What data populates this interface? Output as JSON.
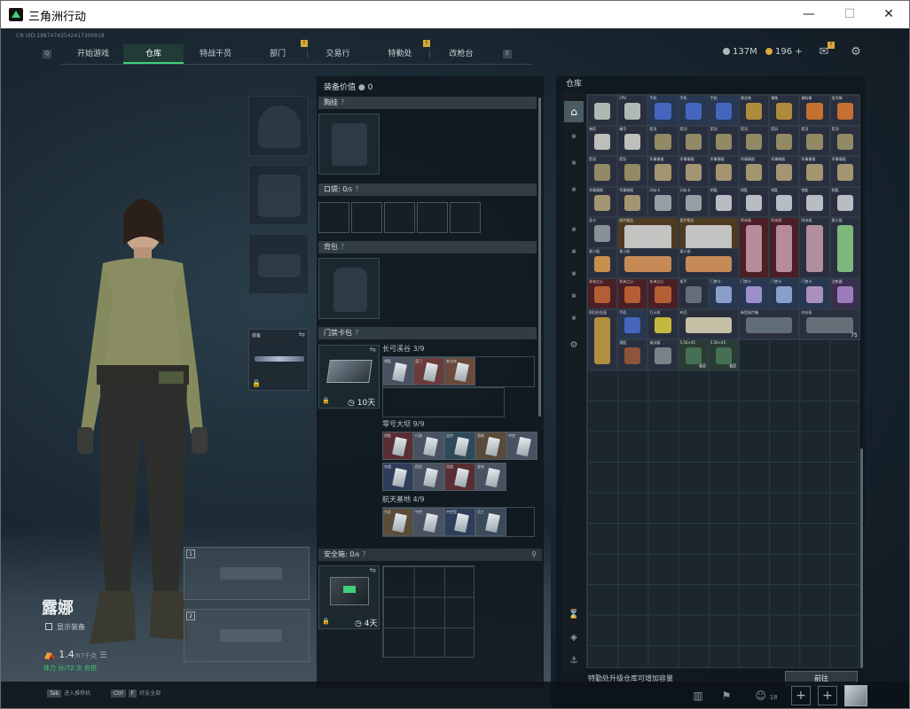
{
  "window": {
    "title": "三角洲行动",
    "minimize": "—",
    "maximize": "☐",
    "close": "✕"
  },
  "uid": "CN UID:18874742542417300918",
  "nav": {
    "left_key": "Q",
    "right_key": "E",
    "tabs": [
      {
        "label": "开始游戏"
      },
      {
        "label": "仓库",
        "active": true
      },
      {
        "label": "特战干员"
      },
      {
        "label": "部门",
        "badge": "!"
      },
      {
        "label": "交易行"
      },
      {
        "label": "特勤处",
        "badge": "!"
      },
      {
        "label": "改枪台"
      }
    ]
  },
  "currency": {
    "primary": "137M",
    "secondary": "196",
    "plus": "+"
  },
  "character": {
    "name": "露娜",
    "show_gear": "显示装备",
    "weight": "1.4",
    "weight_max": "/87千克",
    "weight_status": "体力 分/72 次 负担",
    "weapon_slot_title": "装备",
    "primary_slot": "1",
    "secondary_slot": "2"
  },
  "loadout": {
    "equip_value_label": "装备价值",
    "equip_value": "0",
    "chest": "胸挂",
    "pocket": "口袋",
    "pocket_count": "0",
    "pocket_max": "/5",
    "backpack": "背包",
    "keycard": "门禁卡包",
    "keycard_timer": "10天",
    "safebox": "安全箱",
    "safebox_count": "0",
    "safebox_max": "/6",
    "safebox_timer": "4天",
    "maps": [
      {
        "name": "长弓溪谷",
        "count": "3/9",
        "cards": [
          "钥匙",
          "蓝门",
          "老仓库"
        ]
      },
      {
        "name": "零号大坝",
        "count": "9/9",
        "cards": [
          "钥匙",
          "行政",
          "监控",
          "酒吧",
          "中控",
          "东楼",
          "宿舍",
          "西楼",
          "变电"
        ]
      },
      {
        "name": "航天基地",
        "count": "4/9",
        "cards": [
          "东区",
          "中控",
          "中控室",
          "员工"
        ]
      }
    ]
  },
  "storage": {
    "title": "仓库",
    "footer": "特勤处升级仓库可增加容量",
    "go_button": "前往",
    "items": [
      {
        "name": "",
        "bg": "dark",
        "glyph": "#c8d0c8"
      },
      {
        "name": "CPU",
        "bg": "dark",
        "glyph": "#c8d0c8"
      },
      {
        "name": "手机",
        "bg": "blue",
        "glyph": "#4a6fd0"
      },
      {
        "name": "手机",
        "bg": "blue",
        "glyph": "#4a6fd0"
      },
      {
        "name": "手机",
        "bg": "blue",
        "glyph": "#4a6fd0"
      },
      {
        "name": "黄金笔",
        "bg": "dark",
        "glyph": "#c69b3c"
      },
      {
        "name": "钢笔",
        "bg": "dark",
        "glyph": "#c69b3c"
      },
      {
        "name": "燃料棒",
        "bg": "dark",
        "glyph": "#e07a2f"
      },
      {
        "name": "信号棒",
        "bg": "dark",
        "glyph": "#e07a2f"
      },
      {
        "name": "弹药",
        "bg": "dark",
        "glyph": "#d8d8d0"
      },
      {
        "name": "硬币",
        "bg": "dark",
        "glyph": "#d8d8d0"
      },
      {
        "name": "箭羽",
        "bg": "dark",
        "glyph": "#a39a6b"
      },
      {
        "name": "箭羽",
        "bg": "dark",
        "glyph": "#a39a6b"
      },
      {
        "name": "箭羽",
        "bg": "dark",
        "glyph": "#a39a6b"
      },
      {
        "name": "箭羽",
        "bg": "dark",
        "glyph": "#a39a6b"
      },
      {
        "name": "箭羽",
        "bg": "dark",
        "glyph": "#a39a6b"
      },
      {
        "name": "箭羽",
        "bg": "dark",
        "glyph": "#a39a6b"
      },
      {
        "name": "箭羽",
        "bg": "dark",
        "glyph": "#a39a6b"
      },
      {
        "name": "箭羽",
        "bg": "dark",
        "glyph": "#a39a6b"
      },
      {
        "name": "箭羽",
        "bg": "dark",
        "glyph": "#a39a6b"
      },
      {
        "name": "军事情报",
        "bg": "dark",
        "glyph": "#b9a77a"
      },
      {
        "name": "军事情报",
        "bg": "dark",
        "glyph": "#b9a77a"
      },
      {
        "name": "军事情报",
        "bg": "dark",
        "glyph": "#b9a77a"
      },
      {
        "name": "军事情报",
        "bg": "dark",
        "glyph": "#b9a77a"
      },
      {
        "name": "军事情报",
        "bg": "dark",
        "glyph": "#b9a77a"
      },
      {
        "name": "军事情报",
        "bg": "dark",
        "glyph": "#b9a77a"
      },
      {
        "name": "军事情报",
        "bg": "dark",
        "glyph": "#b9a77a"
      },
      {
        "name": "军事情报",
        "bg": "dark",
        "glyph": "#b9a77a"
      },
      {
        "name": "军事情报",
        "bg": "dark",
        "glyph": "#b9a77a"
      },
      {
        "name": "闪存卡",
        "bg": "dark",
        "glyph": "#aab0b6"
      },
      {
        "name": "闪存卡",
        "bg": "dark",
        "glyph": "#aab0b6"
      },
      {
        "name": "钥匙",
        "bg": "dark",
        "glyph": "#d0d6da"
      },
      {
        "name": "钥匙",
        "bg": "dark",
        "glyph": "#d0d6da"
      },
      {
        "name": "钥匙",
        "bg": "dark",
        "glyph": "#d0d6da"
      },
      {
        "name": "钥匙",
        "bg": "dark",
        "glyph": "#d0d6da"
      },
      {
        "name": "钥匙",
        "bg": "dark",
        "glyph": "#d0d6da"
      }
    ],
    "row5": [
      {
        "name": "显卡",
        "count": ""
      },
      {
        "name": "医疗报告",
        "count": ""
      },
      {
        "name": "医疗报告",
        "count": ""
      },
      {
        "name": "阿米娅",
        "count": ""
      },
      {
        "name": "阿米娅",
        "count": ""
      },
      {
        "name": "阿米娅",
        "count": ""
      },
      {
        "name": "麦小丽",
        "count": ""
      }
    ],
    "row6": [
      {
        "name": "麦小丽"
      },
      {
        "name": "麦小丽"
      },
      {
        "name": "麦小丽"
      },
      {
        "name": "麦小丽"
      },
      {
        "name": "麦小丽"
      },
      {
        "name": "黑鳞"
      }
    ],
    "row7": [
      {
        "name": "非洲之心"
      },
      {
        "name": "非洲之心"
      },
      {
        "name": "非洲之心"
      },
      {
        "name": "扳手"
      },
      {
        "name": "门禁卡"
      },
      {
        "name": "门禁卡"
      },
      {
        "name": "门禁卡"
      },
      {
        "name": "门禁卡"
      },
      {
        "name": "注射器"
      }
    ],
    "row8": [
      {
        "name": "阿拉伯金壶"
      },
      {
        "name": "手机"
      },
      {
        "name": "打火机"
      },
      {
        "name": "布匹"
      },
      {
        "name": "新型医疗箱",
        "count": ""
      },
      {
        "name": "内存条",
        "count": "75"
      }
    ],
    "row9": [
      {
        "name": "酒瓶"
      },
      {
        "name": "调试器"
      },
      {
        "name": "5.56×45",
        "count": "60"
      },
      {
        "name": "5.56×45",
        "count": "60"
      }
    ]
  },
  "bottom": {
    "tab_key": "Tab",
    "tab_action": "进入推荐机",
    "ctrl_key": "Ctrl",
    "f_key": "F",
    "ctrl_action": "好友全部",
    "friends_count": "18"
  }
}
